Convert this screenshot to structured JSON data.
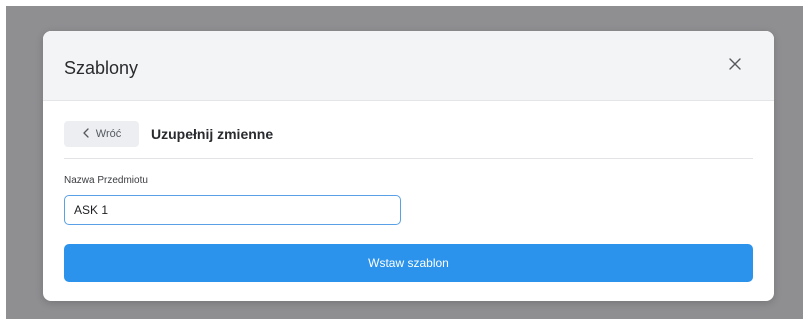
{
  "modal": {
    "title": "Szablony",
    "close_icon": "close-icon"
  },
  "subheader": {
    "back_label": "Wróć",
    "back_icon": "chevron-left-icon",
    "title": "Uzupełnij zmienne"
  },
  "form": {
    "field_label": "Nazwa Przedmiotu",
    "field_value": "ASK 1"
  },
  "actions": {
    "submit_label": "Wstaw szablon"
  },
  "colors": {
    "primary": "#2b93ec",
    "input_focus_border": "#5aa0e6",
    "header_bg": "#f3f4f6",
    "overlay": "#8f8f92"
  }
}
